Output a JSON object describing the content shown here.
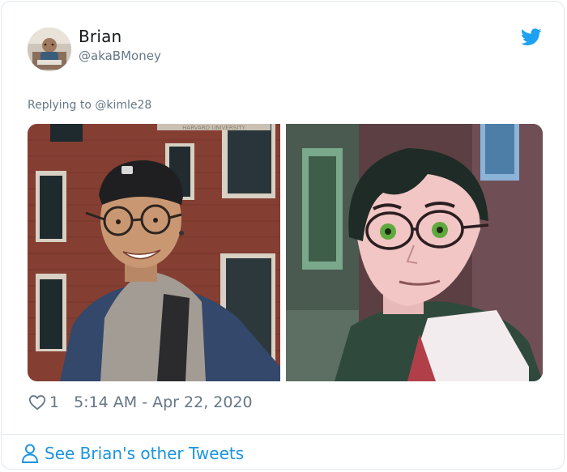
{
  "tweet": {
    "author_name": "Brian",
    "author_handle": "@akaBMoney",
    "replying_prefix": "Replying to ",
    "replying_to": "@kimle28",
    "like_count": "1",
    "timestamp": "5:14 AM - Apr 22, 2020",
    "photo_sign_text": "HARVARD UNIVERSITY"
  },
  "footer": {
    "see_other_label": "See Brian's other Tweets"
  },
  "colors": {
    "twitter_blue": "#1da1f2",
    "link_blue": "#1b95e0",
    "muted_text": "#657786",
    "border": "#e1e8ed"
  },
  "icons": {
    "brand": "twitter-bird-icon",
    "like": "heart-icon",
    "profile": "person-icon"
  }
}
